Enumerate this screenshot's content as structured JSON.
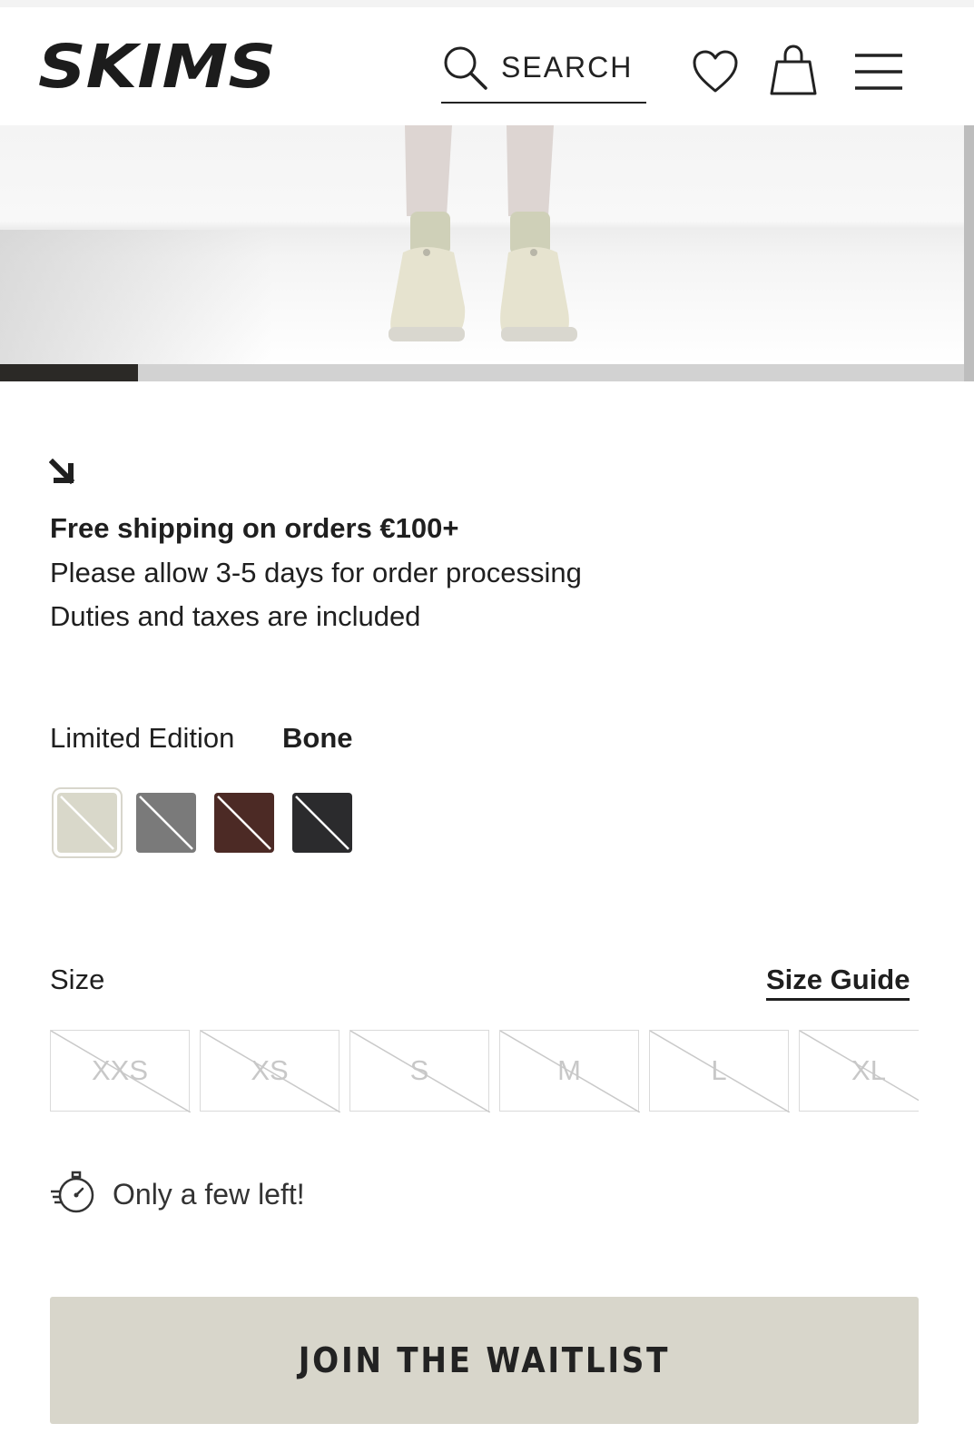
{
  "header": {
    "brand": "SKIMS",
    "search_label": "SEARCH",
    "icons": [
      "search-icon",
      "heart-icon",
      "bag-icon",
      "menu-icon"
    ]
  },
  "gallery": {
    "progress_fraction": 0.143
  },
  "shipping": {
    "headline": "Free shipping on orders €100+",
    "processing": "Please allow 3-5 days for order processing",
    "duties": "Duties and taxes are included"
  },
  "color": {
    "label": "Limited Edition",
    "selected": "Bone",
    "swatches": [
      {
        "name": "Bone",
        "hex": "#d9d8ca",
        "selected": true
      },
      {
        "name": "Gray",
        "hex": "#7a7a7a",
        "selected": false
      },
      {
        "name": "Brown",
        "hex": "#4c2a25",
        "selected": false
      },
      {
        "name": "Black",
        "hex": "#2b2b2d",
        "selected": false
      }
    ]
  },
  "size": {
    "label": "Size",
    "guide_label": "Size Guide",
    "options": [
      "XXS",
      "XS",
      "S",
      "M",
      "L",
      "XL"
    ]
  },
  "stock": {
    "message": "Only a few left!"
  },
  "cta": {
    "label": "JOIN THE WAITLIST",
    "color": "#d8d6cb"
  }
}
